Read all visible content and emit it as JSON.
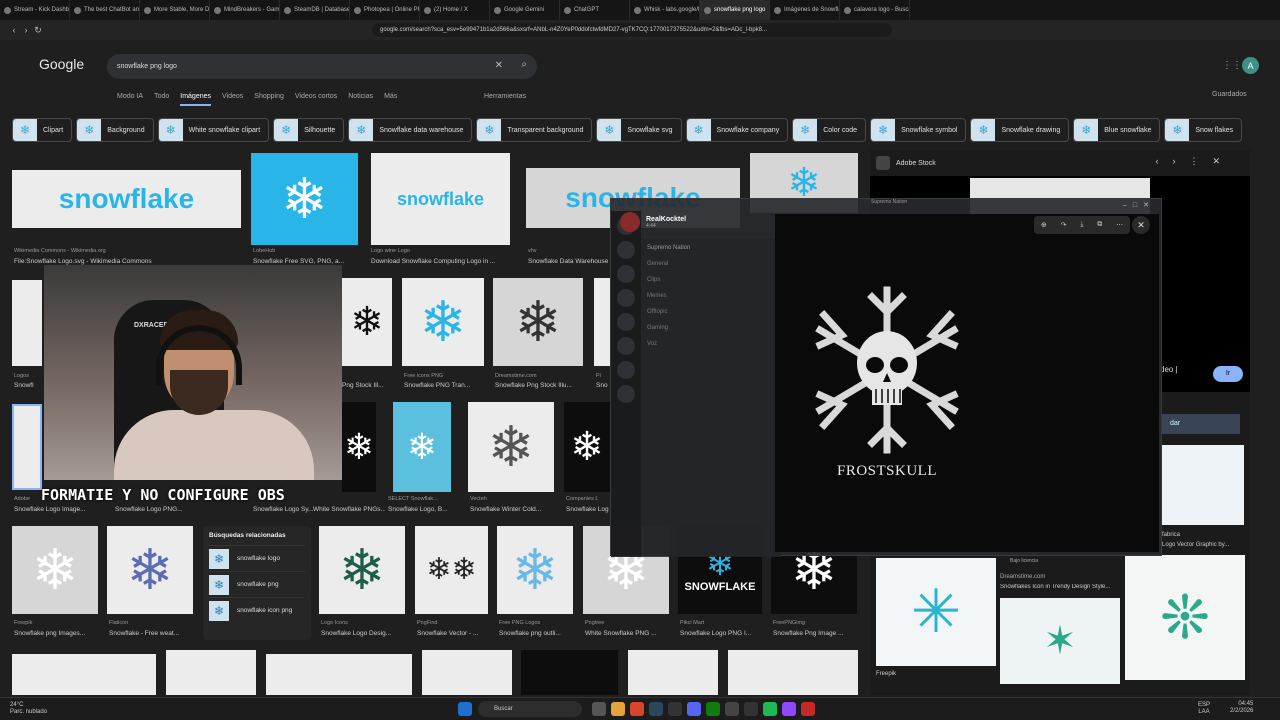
{
  "browser": {
    "tabs": [
      {
        "label": "Stream - Kick Dashb"
      },
      {
        "label": "The best ChatBot and W"
      },
      {
        "label": "More Stable, More Dead"
      },
      {
        "label": "MindBreakers - Gaming"
      },
      {
        "label": "SteamDB | Database of"
      },
      {
        "label": "Photopea | Online Photo"
      },
      {
        "label": "(2) Home / X"
      },
      {
        "label": "Google Gemini"
      },
      {
        "label": "ChatGPT"
      },
      {
        "label": "Whisk - labs.google/fx"
      },
      {
        "label": "snowflake png logo"
      },
      {
        "label": "Imágenes de Snowflake"
      },
      {
        "label": "calavera logo - Buscar co"
      }
    ],
    "url": "google.com/search?sca_esv=5e99471b1a2d566a&sxsrf=ANbL-n4Z0YeP0ddofctwfdMD27-vgTK7CQ:1770017375522&udm=2&fbs=ADc_l-bpk8..."
  },
  "google": {
    "logo": "Google",
    "query": "snowflake png logo",
    "avatar": "A",
    "nav": [
      "Modo IA",
      "Todo",
      "Imágenes",
      "Videos",
      "Shopping",
      "Videos cortos",
      "Noticias",
      "Más"
    ],
    "tools": "Herramientas",
    "saved": "Guardados"
  },
  "chips": [
    "Clipart",
    "Background",
    "White snowflake clipart",
    "Silhouette",
    "Snowflake data warehouse",
    "Transparent background",
    "Snowflake svg",
    "Snowflake company",
    "Color code",
    "Snowflake symbol",
    "Snowflake drawing",
    "Blue snowflake",
    "Snow flakes"
  ],
  "results": {
    "row1": [
      {
        "src": "Wikimedia Commons - Wikimedia.org",
        "cap": "File:Snowflake Logo.svg - Wikimedia Commons",
        "logo": "snowflake"
      },
      {
        "src": "LobeHub",
        "cap": "Snowflake Free SVG, PNG, a..."
      },
      {
        "src": "Logo wine Logo",
        "cap": "Download Snowflake Computing Logo in ...",
        "logo": "snowflake"
      },
      {
        "src": "vhv",
        "cap": "Snowflake Data Warehouse ...",
        "logo": "snowflake"
      }
    ],
    "row2": [
      {
        "src": "Logos",
        "cap": "Snowfl"
      },
      {
        "src": "",
        "cap": "Png Stock Ill..."
      },
      {
        "src": "Free icons PNG",
        "cap": "Snowflake PNG Tran..."
      },
      {
        "src": "Dreamstime.com",
        "cap": "Snowflake Png Stock Illu..."
      },
      {
        "src": "Pi",
        "cap": "Sno"
      }
    ],
    "row3": [
      {
        "src": "Adobe",
        "cap": "Snowflake Logo Image..."
      },
      {
        "src": "",
        "cap": "Snowflake Logo PNG..."
      },
      {
        "src": "",
        "cap": "Snowflake Logo Sy..."
      },
      {
        "src": "",
        "cap": "White Snowflake PNGs..."
      },
      {
        "src": "SELECT Snowflak...",
        "cap": "Snowflake Logo, B..."
      },
      {
        "src": "Vecteh",
        "cap": "Snowflake Winter Cold..."
      },
      {
        "src": "Companies L",
        "cap": "Snowflake Log"
      }
    ],
    "row4": [
      {
        "src": "Freepik",
        "cap": "Snowflake png Images..."
      },
      {
        "src": "Flaticon",
        "cap": "Snowflake - Free weat..."
      },
      {
        "src": "Logo Icons",
        "cap": "Snowflake Logo Desig..."
      },
      {
        "src": "PngFind",
        "cap": "Snowflake Vector - ..."
      },
      {
        "src": "Free PNG Logos",
        "cap": "Snowflake png outli..."
      },
      {
        "src": "Pngtree",
        "cap": "White Snowflake PNG ..."
      },
      {
        "src": "Pikci Mart",
        "cap": "Snowflake Logo PNG I..."
      },
      {
        "src": "FreePNGimg",
        "cap": "Snowflake Png Image ..."
      }
    ],
    "snowflake_word": "SNOWFLAKE"
  },
  "related": {
    "heading": "Búsquedas relacionadas",
    "items": [
      "snowflake logo",
      "snowflake png",
      "snowflake icon png"
    ]
  },
  "right_panel": {
    "source": "Adobe Stock",
    "ir": "Ir",
    "ideo": "deo |",
    "dar": "dar",
    "fabrica": "fabrica",
    "vector_cap": "Logo Vector Graphic by...",
    "bajo_licencia": "Bajo licencia",
    "dreamstime_src": "Dreamstime.com",
    "dreamstime_cap": "Snowflakes Icon in Trendy Design Style...",
    "freepik": "Freepik"
  },
  "stream": {
    "overlay_text": "FORMATIE Y NO CONFIGURE OBS",
    "chair_brand": "DXRACER"
  },
  "discord": {
    "username": "RealKocktel",
    "time": "4:44",
    "server": "Supremo Nation",
    "logo_text": "FROSTSKULL",
    "sidebar_channels": [
      "General",
      "Clips",
      "Memes",
      "Offtopic",
      "Gaming",
      "Voz"
    ]
  },
  "taskbar": {
    "temp": "24°C",
    "weather": "Parc. nublado",
    "search": "Buscar",
    "lang1": "ESP",
    "lang2": "LAA",
    "time": "04:45",
    "date": "2/2/2026"
  }
}
